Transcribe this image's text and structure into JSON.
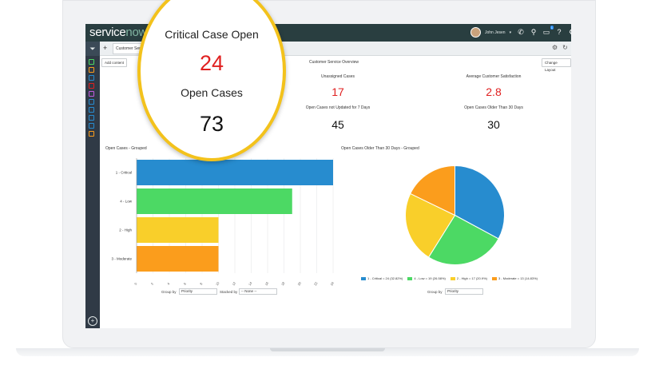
{
  "app": {
    "brand_service": "service",
    "brand_now": "now",
    "user_name": "John Jesen",
    "notification_count": "1",
    "tab_label": "Customer Servic..."
  },
  "toolbar": {
    "add_content": "Add content",
    "change_layout": "Change Layout",
    "overview_title": "Customer Service Overview"
  },
  "metrics": [
    {
      "label": "Unassigned Cases",
      "value": "17",
      "color": "#e02020"
    },
    {
      "label": "Average Customer Satisfaction",
      "value": "2.8",
      "color": "#e02020"
    },
    {
      "label": "Open Cases not Updated for 7 Days",
      "value": "45",
      "color": "#111111"
    },
    {
      "label": "Open Cases Older Than 30 Days",
      "value": "30",
      "color": "#111111"
    }
  ],
  "magnifier": {
    "critical_label": "Critical Case Open",
    "critical_value": "24",
    "open_label": "Open Cases",
    "open_value": "73",
    "ring_color": "#f3c21c"
  },
  "bar_controls": {
    "group_by_label": "Group by",
    "group_by_value": "Priority",
    "stacked_by_label": "Stacked by",
    "stacked_by_value": "-- None --"
  },
  "pie_controls": {
    "group_by_label": "Group by",
    "group_by_value": "Priority"
  },
  "chart_data": [
    {
      "type": "bar",
      "orientation": "horizontal",
      "title": "Open Cases - Grouped",
      "categories": [
        "1 - Critical",
        "4 - Low",
        "2 - High",
        "3 - Moderate"
      ],
      "values": [
        24,
        19,
        10,
        10
      ],
      "colors": [
        "#278ccf",
        "#4cd964",
        "#f9cf2a",
        "#fb9d1c"
      ],
      "xlim": [
        0,
        24
      ],
      "xticks": [
        "0",
        "2",
        "4",
        "6",
        "8",
        "10",
        "12",
        "14",
        "16",
        "18",
        "20",
        "22",
        "24"
      ],
      "grid": true
    },
    {
      "type": "pie",
      "title": "Open Cases Older Than 30 Days - Grouped",
      "labels": [
        "1 - Critical",
        "4 - Low",
        "2 - High",
        "3 - Moderate"
      ],
      "values": [
        24,
        19,
        17,
        13
      ],
      "legend": [
        "1 - Critical = 24 (32.82%)",
        "4 - Low = 19 (26.58%)",
        "2 - High = 17 (20.9%)",
        "3 - Moderate = 13 (14.83%)"
      ],
      "colors": [
        "#278ccf",
        "#4cd964",
        "#f9cf2a",
        "#fb9d1c"
      ],
      "legend_position": "bottom"
    }
  ]
}
